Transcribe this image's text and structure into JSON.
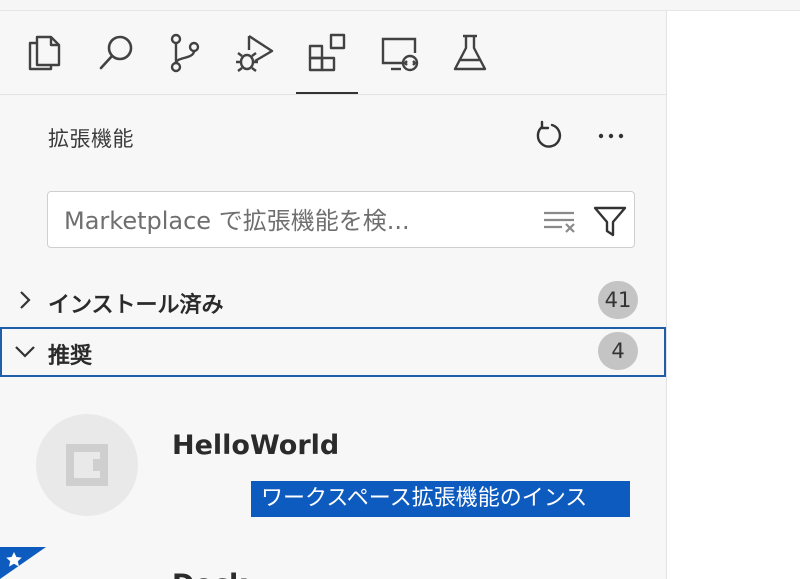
{
  "activity_bar": {
    "items": [
      {
        "name": "explorer-icon"
      },
      {
        "name": "search-icon"
      },
      {
        "name": "source-control-icon"
      },
      {
        "name": "run-debug-icon"
      },
      {
        "name": "extensions-icon",
        "active": true
      },
      {
        "name": "remote-explorer-icon"
      },
      {
        "name": "testing-icon"
      }
    ]
  },
  "panel": {
    "title": "拡張機能",
    "actions": [
      "refresh-icon",
      "more-icon"
    ]
  },
  "search": {
    "placeholder": "Marketplace で拡張機能を検...",
    "value": ""
  },
  "sections": [
    {
      "label": "インストール済み",
      "count": "41",
      "expanded": false
    },
    {
      "label": "推奨",
      "count": "4",
      "expanded": true
    }
  ],
  "recommended": {
    "extension_name": "HelloWorld",
    "install_button": "ワークスペース拡張機能のインス",
    "next_extension_name": "Dock..."
  },
  "colors": {
    "accent": "#0e5bc0",
    "focus_border": "#1f5fa8",
    "count_badge": "#c4c4c4",
    "sidebar_bg": "#f7f7f7"
  }
}
